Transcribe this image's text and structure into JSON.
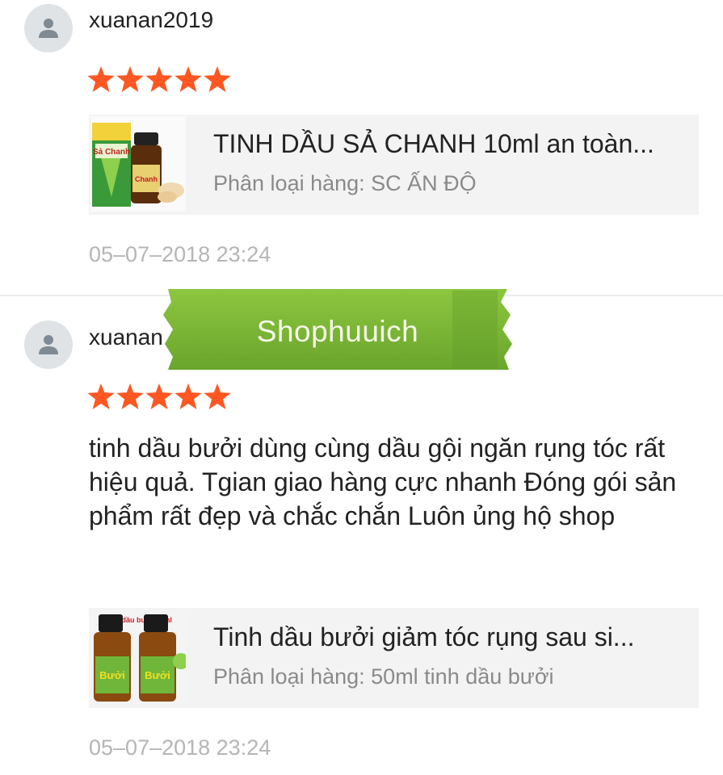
{
  "reviews": [
    {
      "username": "xuanan2019",
      "rating": 5,
      "comment": "",
      "product": {
        "name": "TINH DẦU SẢ CHANH 10ml an toàn...",
        "variation": "Phân loại hàng: SC ẤN ĐỘ",
        "thumb_label": "Sả Chanh"
      },
      "date": "05–07–2018 23:24"
    },
    {
      "username": "xuanan",
      "rating": 5,
      "comment": "tinh dầu bưởi dùng cùng dầu gội ngăn rụng tóc rất hiệu quả. Tgian giao hàng cực nhanh Đóng gói sản phẩm rất đẹp và chắc chắn Luôn ủng hộ shop",
      "product": {
        "name": "Tinh dầu bưởi giảm tóc rụng sau si...",
        "variation": "Phân loại hàng: 50ml tinh dầu bưởi",
        "thumb_label": "Bưởi",
        "thumb_caption": "Tinh dầu bưởi 50ml"
      },
      "date": "05–07–2018 23:24"
    }
  ],
  "watermark": {
    "text": "Shophuuich"
  },
  "colors": {
    "star": "#fe5722",
    "watermark": "#7fb435"
  },
  "icons": {
    "avatar": "user-icon",
    "star": "star-icon"
  }
}
